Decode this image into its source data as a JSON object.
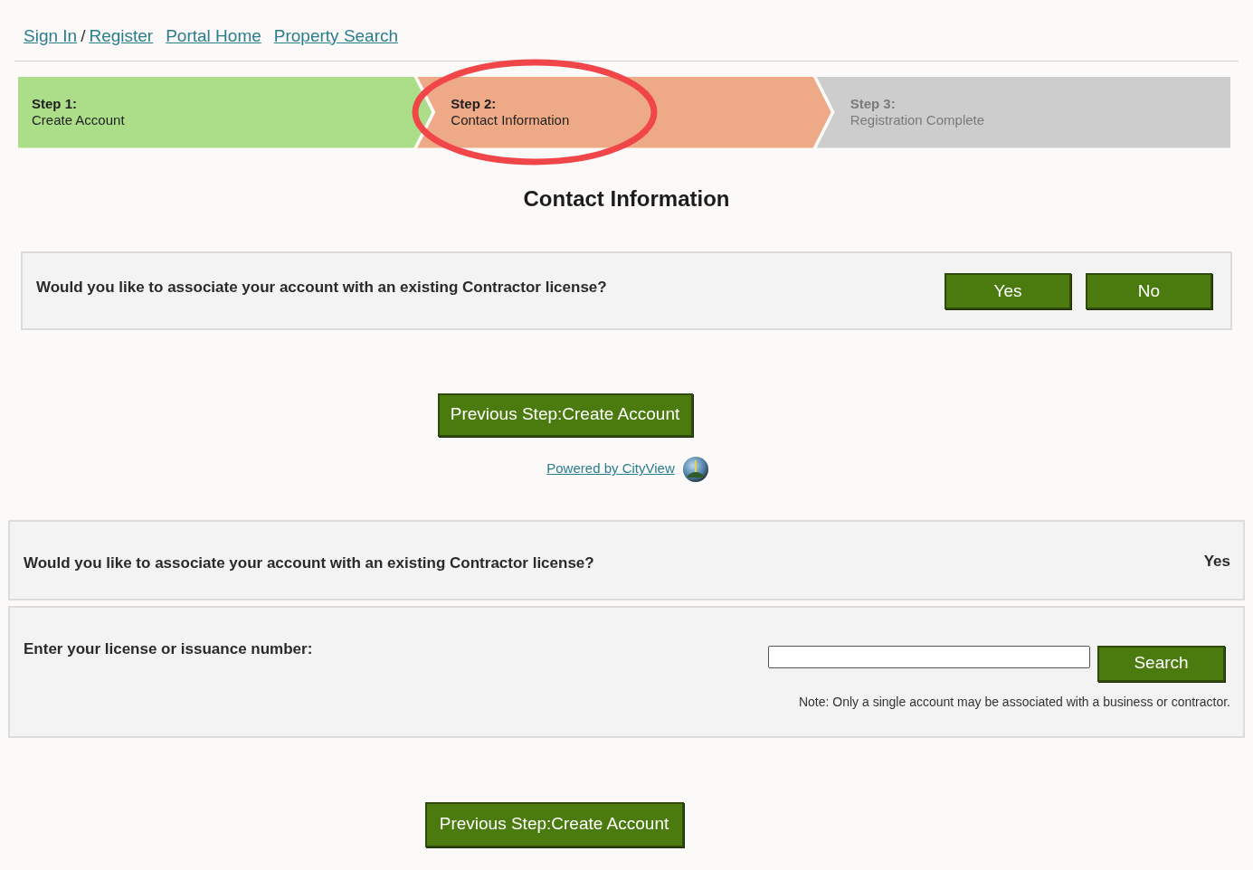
{
  "nav_links": [
    {
      "label": "Sign In",
      "separator_after": "/"
    },
    {
      "label": "Register"
    },
    {
      "label": "Portal Home"
    },
    {
      "label": "Property Search"
    }
  ],
  "steps": [
    {
      "kind": "complete",
      "number": "Step 1:",
      "label": "Create Account",
      "circled": false
    },
    {
      "kind": "current",
      "number": "Step 2:",
      "label": "Contact Information",
      "circled": true
    },
    {
      "kind": "pending",
      "number": "Step 3:",
      "label": "Registration Complete",
      "circled": false
    }
  ],
  "page_title": "Contact Information",
  "question_panel": {
    "question": "Would you like to associate your account with an existing Contractor license?",
    "buttons": [
      "Yes",
      "No"
    ]
  },
  "previous_button": "Previous Step:Create Account",
  "powered_by": "Powered by CityView",
  "answer_panel": {
    "question": "Would you like to associate your account with an existing Contractor license?",
    "answer": "Yes"
  },
  "license_panel": {
    "label": "Enter your license or issuance number:",
    "search_button": "Search",
    "note": "Note: Only a single account may be associated with a business or contractor."
  },
  "bottom_previous_button": "Previous Step:Create Account"
}
